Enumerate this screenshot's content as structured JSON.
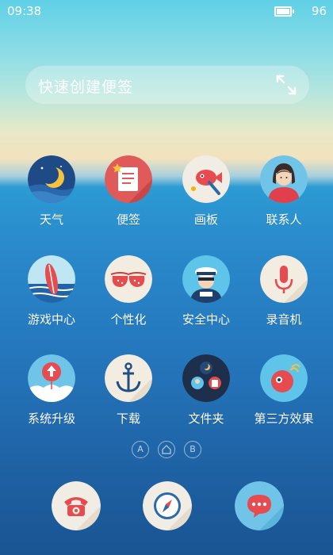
{
  "status_bar": {
    "time": "09:38",
    "battery": "96"
  },
  "note_widget": {
    "label": "快速创建便签",
    "action_icon": "expand-icon"
  },
  "apps": [
    {
      "name": "weather",
      "label": "天气",
      "icon": "moon-night-icon"
    },
    {
      "name": "notes",
      "label": "便签",
      "icon": "notepad-icon"
    },
    {
      "name": "drawing-board",
      "label": "画板",
      "icon": "paint-fish-icon"
    },
    {
      "name": "contacts",
      "label": "联系人",
      "icon": "person-avatar-icon"
    },
    {
      "name": "game-center",
      "label": "游戏中心",
      "icon": "surfboard-icon"
    },
    {
      "name": "personalization",
      "label": "个性化",
      "icon": "bikini-icon"
    },
    {
      "name": "security-center",
      "label": "安全中心",
      "icon": "sailor-icon"
    },
    {
      "name": "recorder",
      "label": "录音机",
      "icon": "microphone-icon"
    },
    {
      "name": "system-update",
      "label": "系统升级",
      "icon": "balloon-upload-icon"
    },
    {
      "name": "downloads",
      "label": "下载",
      "icon": "anchor-icon"
    },
    {
      "name": "file-manager",
      "label": "文件夹",
      "icon": "folder-collage-icon"
    },
    {
      "name": "third-party-effects",
      "label": "第三方效果",
      "icon": "red-fish-icon"
    }
  ],
  "page_indicator": {
    "pages": [
      "A",
      "home",
      "B"
    ],
    "current": "A"
  },
  "dock": [
    {
      "name": "phone",
      "icon": "telephone-icon"
    },
    {
      "name": "browser",
      "icon": "compass-icon"
    },
    {
      "name": "messages",
      "icon": "chat-bubble-icon"
    }
  ]
}
